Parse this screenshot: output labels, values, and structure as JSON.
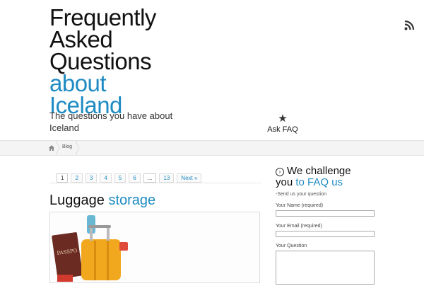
{
  "header": {
    "title_dark": [
      "Frequently",
      "Asked",
      "Questions"
    ],
    "title_blue": [
      "about",
      "Iceland"
    ],
    "tagline": "The questions you have about Iceland",
    "ask_label": "Ask FAQ",
    "star_glyph": "★"
  },
  "breadcrumb": {
    "current": "Blog"
  },
  "pagination": [
    "1",
    "2",
    "3",
    "4",
    "5",
    "6",
    "...",
    "13",
    "Next »"
  ],
  "post": {
    "title_word1": "Luggage",
    "title_word2": "storage"
  },
  "sidebar": {
    "heading_w1": "We challenge",
    "heading_w2": "you",
    "heading_w3": "to FAQ us",
    "subtitle": "-Send us your question",
    "name_label": "Your Name (required)",
    "email_label": "Your Email (required)",
    "question_label": "Your Question"
  },
  "colors": {
    "accent": "#1e8bc3",
    "text": "#111111",
    "bar": "#f4f4f4"
  }
}
